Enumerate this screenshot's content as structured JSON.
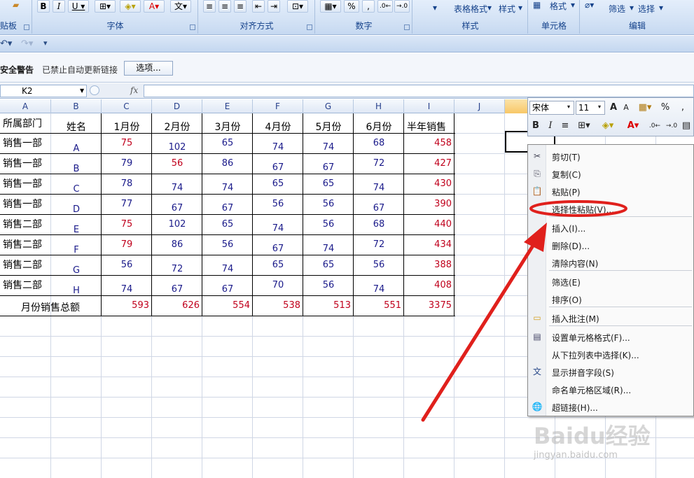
{
  "ribbon": {
    "groups": {
      "clipboard_label": "贴板",
      "font_label": "字体",
      "alignment_label": "对齐方式",
      "number_label": "数字",
      "styles_label": "样式",
      "cells_label": "单元格",
      "editing_label": "编辑"
    },
    "table_format": "表格格式",
    "style_btn": "样式",
    "format_btn": "格式",
    "filter_btn": "筛选",
    "select_btn": "选择",
    "percent": "%",
    "comma": ","
  },
  "security": {
    "title": "安全警告",
    "message": "已禁止自动更新链接",
    "options_button": "选项..."
  },
  "formula_bar": {
    "name_box": "K2",
    "fx": "fx",
    "formula": ""
  },
  "columns": [
    "A",
    "B",
    "C",
    "D",
    "E",
    "F",
    "G",
    "H",
    "I",
    "J"
  ],
  "table": {
    "headers": [
      "所属部门",
      "姓名",
      "1月份",
      "2月份",
      "3月份",
      "4月份",
      "5月份",
      "6月份",
      "半年销售"
    ],
    "rows": [
      {
        "dept": "销售一部",
        "name": "A",
        "m": [
          "75",
          "102",
          "65",
          "74",
          "74",
          "68"
        ],
        "total": "458"
      },
      {
        "dept": "销售一部",
        "name": "B",
        "m": [
          "79",
          "56",
          "86",
          "67",
          "67",
          "72"
        ],
        "total": "427"
      },
      {
        "dept": "销售一部",
        "name": "C",
        "m": [
          "78",
          "74",
          "74",
          "65",
          "65",
          "74"
        ],
        "total": "430"
      },
      {
        "dept": "销售一部",
        "name": "D",
        "m": [
          "77",
          "67",
          "67",
          "56",
          "56",
          "67"
        ],
        "total": "390"
      },
      {
        "dept": "销售二部",
        "name": "E",
        "m": [
          "75",
          "102",
          "65",
          "74",
          "56",
          "68"
        ],
        "total": "440"
      },
      {
        "dept": "销售二部",
        "name": "F",
        "m": [
          "79",
          "86",
          "56",
          "67",
          "74",
          "72"
        ],
        "total": "434"
      },
      {
        "dept": "销售二部",
        "name": "G",
        "m": [
          "56",
          "72",
          "74",
          "65",
          "65",
          "56"
        ],
        "total": "388"
      },
      {
        "dept": "销售二部",
        "name": "H",
        "m": [
          "74",
          "67",
          "67",
          "70",
          "56",
          "74"
        ],
        "total": "408"
      }
    ],
    "total_label": "月份销售总额",
    "totals": [
      "593",
      "626",
      "554",
      "538",
      "513",
      "551",
      "3375"
    ]
  },
  "mini_toolbar": {
    "font": "宋体",
    "size": "11",
    "grow": "A",
    "shrink": "A",
    "percent": "%",
    "comma": ",",
    "bold": "B",
    "italic": "I"
  },
  "context_menu": {
    "items": [
      {
        "label": "剪切(T)",
        "icon": "scissors-icon"
      },
      {
        "label": "复制(C)",
        "icon": "copy-icon"
      },
      {
        "label": "粘贴(P)",
        "icon": "paste-icon"
      },
      {
        "label": "选择性粘贴(V)...",
        "icon": ""
      },
      {
        "label": "插入(I)...",
        "icon": ""
      },
      {
        "label": "删除(D)...",
        "icon": ""
      },
      {
        "label": "清除内容(N)",
        "icon": ""
      },
      {
        "label": "筛选(E)",
        "icon": ""
      },
      {
        "label": "排序(O)",
        "icon": ""
      },
      {
        "label": "插入批注(M)",
        "icon": "comment-icon"
      },
      {
        "label": "设置单元格格式(F)...",
        "icon": "format-cells-icon"
      },
      {
        "label": "从下拉列表中选择(K)...",
        "icon": ""
      },
      {
        "label": "显示拼音字段(S)",
        "icon": "phonetic-icon"
      },
      {
        "label": "命名单元格区域(R)...",
        "icon": ""
      },
      {
        "label": "超链接(H)...",
        "icon": "hyperlink-icon"
      }
    ]
  },
  "watermark": {
    "brand": "Baidu经验",
    "url": "jingyan.baidu.com"
  },
  "colors": {
    "annotation_red": "#e0201c",
    "ribbon_text": "#15428b",
    "value_red": "#c0001c",
    "value_blue": "#1a1a8a"
  }
}
